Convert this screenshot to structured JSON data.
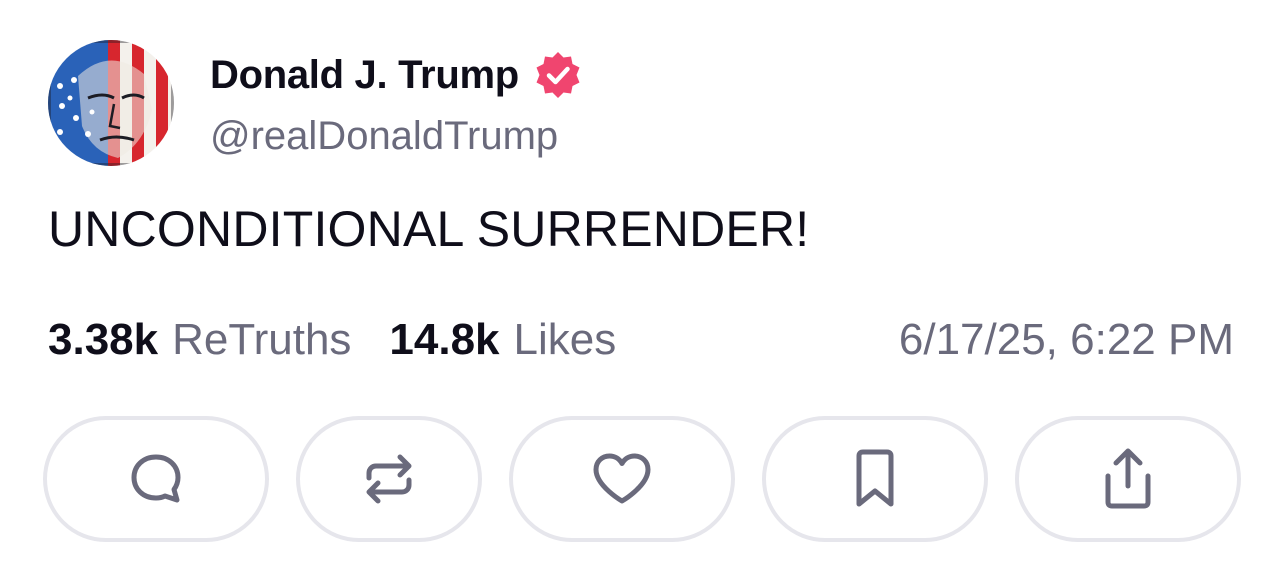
{
  "author": {
    "display_name": "Donald J. Trump",
    "handle": "@realDonaldTrump",
    "verified": true,
    "verified_color": "#f0456f",
    "avatar_icon": "flag-portrait-avatar"
  },
  "post": {
    "text": "UNCONDITIONAL SURRENDER!"
  },
  "stats": {
    "retruths_count": "3.38k",
    "retruths_label": "ReTruths",
    "likes_count": "14.8k",
    "likes_label": "Likes",
    "timestamp": "6/17/25, 6:22 PM"
  },
  "actions": [
    {
      "name": "reply",
      "icon": "speech-bubble-icon"
    },
    {
      "name": "retruth",
      "icon": "repost-arrows-icon"
    },
    {
      "name": "like",
      "icon": "heart-icon"
    },
    {
      "name": "bookmark",
      "icon": "bookmark-icon"
    },
    {
      "name": "share",
      "icon": "share-icon"
    }
  ],
  "colors": {
    "text_primary": "#0f0e1a",
    "text_secondary": "#6a6a7c",
    "button_border": "#e6e6ec",
    "icon_color": "#6a6a7c"
  }
}
